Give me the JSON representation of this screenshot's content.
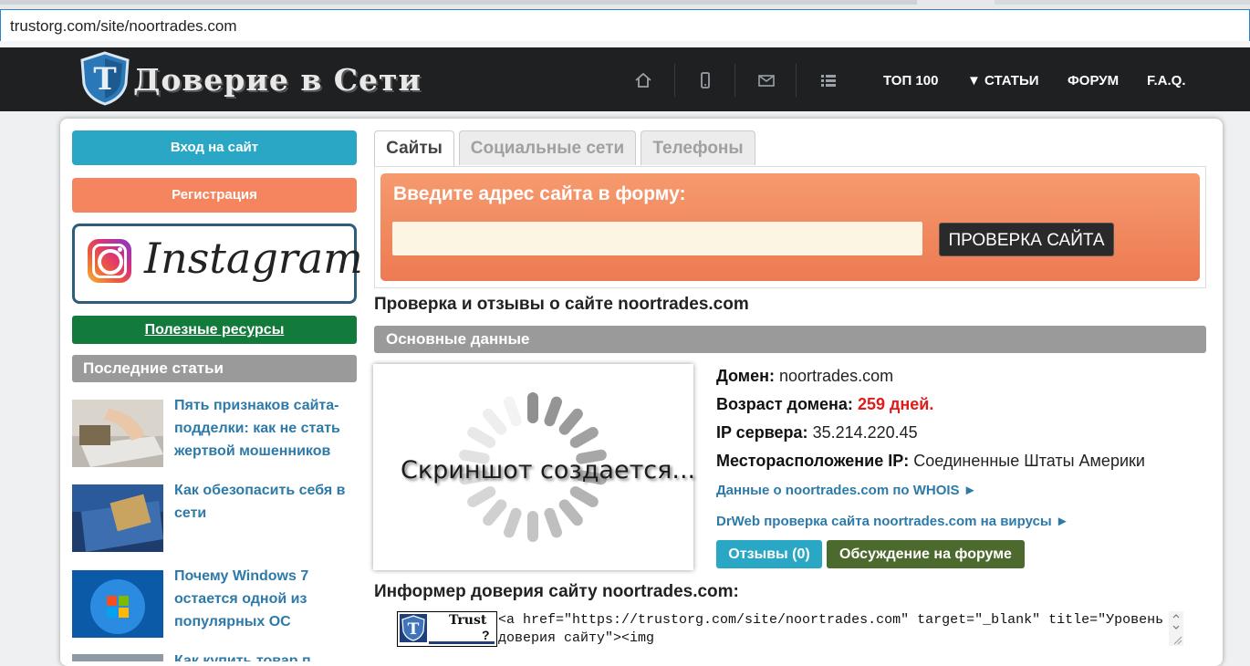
{
  "browser": {
    "url": "trustorg.com/site/noortrades.com"
  },
  "header": {
    "logo_text": "Доверие в Сети",
    "icons": [
      "home-icon",
      "mobile-icon",
      "mail-icon",
      "list-icon"
    ],
    "nav": [
      "ТОП 100",
      "▼ СТАТЬИ",
      "ФОРУМ",
      "F.A.Q."
    ]
  },
  "sidebar": {
    "login": "Вход на сайт",
    "register": "Регистрация",
    "instagram_text": "Instagram",
    "useful_resources": "Полезные ресурсы",
    "latest_articles_heading": "Последние статьи",
    "articles": [
      {
        "title": "Пять признаков сайта-подделки: как не стать жертвой мошенников"
      },
      {
        "title": "Как обезопасить себя в сети"
      },
      {
        "title": "Почему Windows 7 остается одной из популярных ОС"
      },
      {
        "title": "Как купить товар п"
      }
    ]
  },
  "tabs": [
    "Сайты",
    "Социальные сети",
    "Телефоны"
  ],
  "check_form": {
    "title": "Введите адрес сайта в форму:",
    "input_value": "",
    "button": "ПРОВЕРКА САЙТА"
  },
  "main": {
    "heading": "Проверка и отзывы о сайте noortrades.com",
    "section_title": "Основные данные",
    "screenshot_text": "Скриншот создается...",
    "domain_label": "Домен:",
    "domain_value": "noortrades.com",
    "age_label": "Возраст домена:",
    "age_value": "259 дней.",
    "ip_label": "IP сервера:",
    "ip_value": "35.214.220.45",
    "location_label": "Месторасположение IP:",
    "location_value": "Соединенные Штаты Америки",
    "whois_link": "Данные о noortrades.com по WHOIS ►",
    "drweb_link": "DrWeb проверка сайта noortrades.com на вирусы ►",
    "reviews_button": "Отзывы (0)",
    "forum_button": "Обсуждение на форуме",
    "informer_heading": "Информер доверия сайту noortrades.com:",
    "badge_text": "Trust",
    "badge_mark": "?",
    "informer_code": "<a href=\"https://trustorg.com/site/noortrades.com\" target=\"_blank\" title=\"Уровень доверия сайту\"><img"
  },
  "colors": {
    "header_bg": "#1f2021",
    "login_btn": "#29a7c4",
    "register_btn": "#f4855f",
    "useful_btn": "#127a3a",
    "link": "#2d7aa8",
    "age_red": "#e31a1a",
    "forum_btn": "#4d6a2e"
  }
}
